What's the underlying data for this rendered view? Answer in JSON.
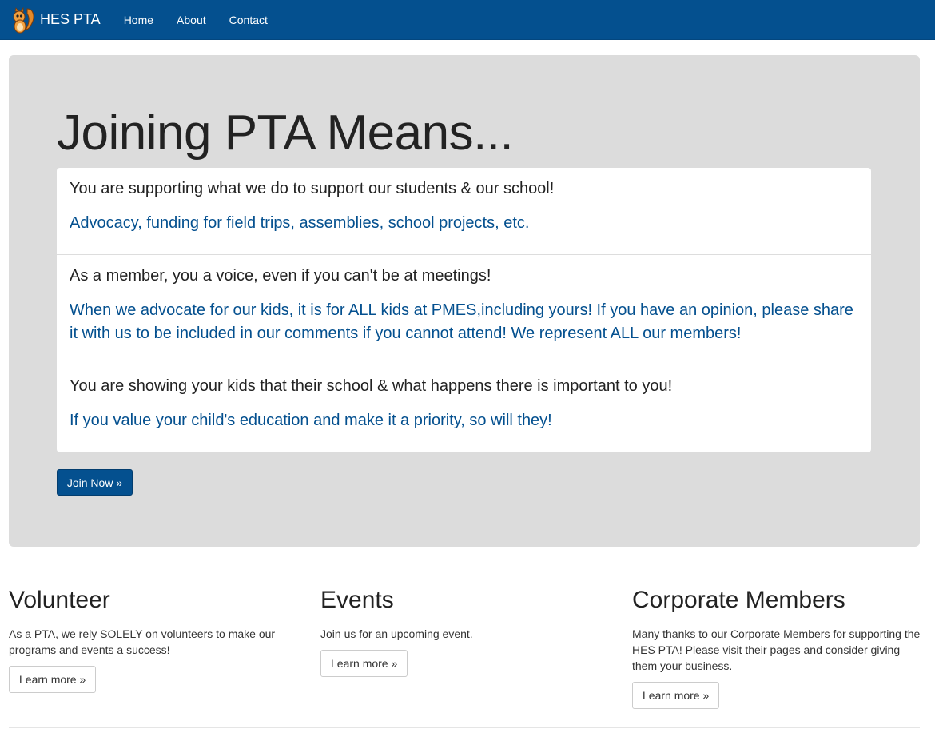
{
  "navbar": {
    "brand": "HES PTA",
    "links": [
      "Home",
      "About",
      "Contact"
    ]
  },
  "jumbotron": {
    "title": "Joining PTA Means...",
    "items": [
      {
        "heading": "You are supporting what we do to support our students & our school!",
        "text": "Advocacy, funding for field trips, assemblies, school projects, etc."
      },
      {
        "heading": "As a member, you a voice, even if you can't be at meetings!",
        "text": "When we advocate for our kids, it is for ALL kids at PMES,including yours! If you have an opinion, please share it with us to be included in our comments if you cannot attend! We represent ALL our members!"
      },
      {
        "heading": "You are showing your kids that their school & what happens there is important to you!",
        "text": "If you value your child's education and make it a priority, so will they!"
      }
    ],
    "button": "Join Now »"
  },
  "columns": [
    {
      "title": "Volunteer",
      "text": "As a PTA, we rely SOLELY on volunteers to make our programs and events a success!",
      "button": "Learn more »"
    },
    {
      "title": "Events",
      "text": "Join us for an upcoming event.",
      "button": "Learn more »"
    },
    {
      "title": "Corporate Members",
      "text": "Many thanks to our Corporate Members for supporting the HES PTA! Please visit their pages and consider giving them your business.",
      "button": "Learn more »"
    }
  ],
  "colors": {
    "navbar": "#04508f",
    "accent_text": "#04508f",
    "jumbotron_bg": "#dcdcdc"
  },
  "icons": {
    "brand_logo": "squirrel-mascot-icon"
  }
}
